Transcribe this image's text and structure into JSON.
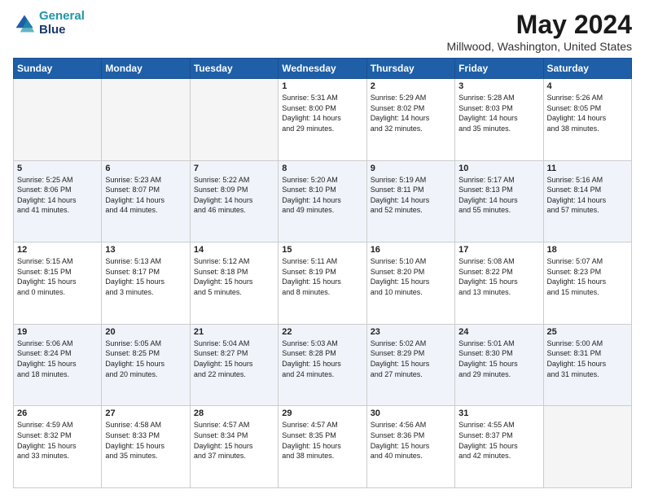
{
  "logo": {
    "line1": "General",
    "line2": "Blue"
  },
  "title": "May 2024",
  "subtitle": "Millwood, Washington, United States",
  "days_header": [
    "Sunday",
    "Monday",
    "Tuesday",
    "Wednesday",
    "Thursday",
    "Friday",
    "Saturday"
  ],
  "weeks": [
    {
      "alt": false,
      "days": [
        {
          "num": "",
          "info": ""
        },
        {
          "num": "",
          "info": ""
        },
        {
          "num": "",
          "info": ""
        },
        {
          "num": "1",
          "info": "Sunrise: 5:31 AM\nSunset: 8:00 PM\nDaylight: 14 hours\nand 29 minutes."
        },
        {
          "num": "2",
          "info": "Sunrise: 5:29 AM\nSunset: 8:02 PM\nDaylight: 14 hours\nand 32 minutes."
        },
        {
          "num": "3",
          "info": "Sunrise: 5:28 AM\nSunset: 8:03 PM\nDaylight: 14 hours\nand 35 minutes."
        },
        {
          "num": "4",
          "info": "Sunrise: 5:26 AM\nSunset: 8:05 PM\nDaylight: 14 hours\nand 38 minutes."
        }
      ]
    },
    {
      "alt": true,
      "days": [
        {
          "num": "5",
          "info": "Sunrise: 5:25 AM\nSunset: 8:06 PM\nDaylight: 14 hours\nand 41 minutes."
        },
        {
          "num": "6",
          "info": "Sunrise: 5:23 AM\nSunset: 8:07 PM\nDaylight: 14 hours\nand 44 minutes."
        },
        {
          "num": "7",
          "info": "Sunrise: 5:22 AM\nSunset: 8:09 PM\nDaylight: 14 hours\nand 46 minutes."
        },
        {
          "num": "8",
          "info": "Sunrise: 5:20 AM\nSunset: 8:10 PM\nDaylight: 14 hours\nand 49 minutes."
        },
        {
          "num": "9",
          "info": "Sunrise: 5:19 AM\nSunset: 8:11 PM\nDaylight: 14 hours\nand 52 minutes."
        },
        {
          "num": "10",
          "info": "Sunrise: 5:17 AM\nSunset: 8:13 PM\nDaylight: 14 hours\nand 55 minutes."
        },
        {
          "num": "11",
          "info": "Sunrise: 5:16 AM\nSunset: 8:14 PM\nDaylight: 14 hours\nand 57 minutes."
        }
      ]
    },
    {
      "alt": false,
      "days": [
        {
          "num": "12",
          "info": "Sunrise: 5:15 AM\nSunset: 8:15 PM\nDaylight: 15 hours\nand 0 minutes."
        },
        {
          "num": "13",
          "info": "Sunrise: 5:13 AM\nSunset: 8:17 PM\nDaylight: 15 hours\nand 3 minutes."
        },
        {
          "num": "14",
          "info": "Sunrise: 5:12 AM\nSunset: 8:18 PM\nDaylight: 15 hours\nand 5 minutes."
        },
        {
          "num": "15",
          "info": "Sunrise: 5:11 AM\nSunset: 8:19 PM\nDaylight: 15 hours\nand 8 minutes."
        },
        {
          "num": "16",
          "info": "Sunrise: 5:10 AM\nSunset: 8:20 PM\nDaylight: 15 hours\nand 10 minutes."
        },
        {
          "num": "17",
          "info": "Sunrise: 5:08 AM\nSunset: 8:22 PM\nDaylight: 15 hours\nand 13 minutes."
        },
        {
          "num": "18",
          "info": "Sunrise: 5:07 AM\nSunset: 8:23 PM\nDaylight: 15 hours\nand 15 minutes."
        }
      ]
    },
    {
      "alt": true,
      "days": [
        {
          "num": "19",
          "info": "Sunrise: 5:06 AM\nSunset: 8:24 PM\nDaylight: 15 hours\nand 18 minutes."
        },
        {
          "num": "20",
          "info": "Sunrise: 5:05 AM\nSunset: 8:25 PM\nDaylight: 15 hours\nand 20 minutes."
        },
        {
          "num": "21",
          "info": "Sunrise: 5:04 AM\nSunset: 8:27 PM\nDaylight: 15 hours\nand 22 minutes."
        },
        {
          "num": "22",
          "info": "Sunrise: 5:03 AM\nSunset: 8:28 PM\nDaylight: 15 hours\nand 24 minutes."
        },
        {
          "num": "23",
          "info": "Sunrise: 5:02 AM\nSunset: 8:29 PM\nDaylight: 15 hours\nand 27 minutes."
        },
        {
          "num": "24",
          "info": "Sunrise: 5:01 AM\nSunset: 8:30 PM\nDaylight: 15 hours\nand 29 minutes."
        },
        {
          "num": "25",
          "info": "Sunrise: 5:00 AM\nSunset: 8:31 PM\nDaylight: 15 hours\nand 31 minutes."
        }
      ]
    },
    {
      "alt": false,
      "days": [
        {
          "num": "26",
          "info": "Sunrise: 4:59 AM\nSunset: 8:32 PM\nDaylight: 15 hours\nand 33 minutes."
        },
        {
          "num": "27",
          "info": "Sunrise: 4:58 AM\nSunset: 8:33 PM\nDaylight: 15 hours\nand 35 minutes."
        },
        {
          "num": "28",
          "info": "Sunrise: 4:57 AM\nSunset: 8:34 PM\nDaylight: 15 hours\nand 37 minutes."
        },
        {
          "num": "29",
          "info": "Sunrise: 4:57 AM\nSunset: 8:35 PM\nDaylight: 15 hours\nand 38 minutes."
        },
        {
          "num": "30",
          "info": "Sunrise: 4:56 AM\nSunset: 8:36 PM\nDaylight: 15 hours\nand 40 minutes."
        },
        {
          "num": "31",
          "info": "Sunrise: 4:55 AM\nSunset: 8:37 PM\nDaylight: 15 hours\nand 42 minutes."
        },
        {
          "num": "",
          "info": ""
        }
      ]
    }
  ]
}
